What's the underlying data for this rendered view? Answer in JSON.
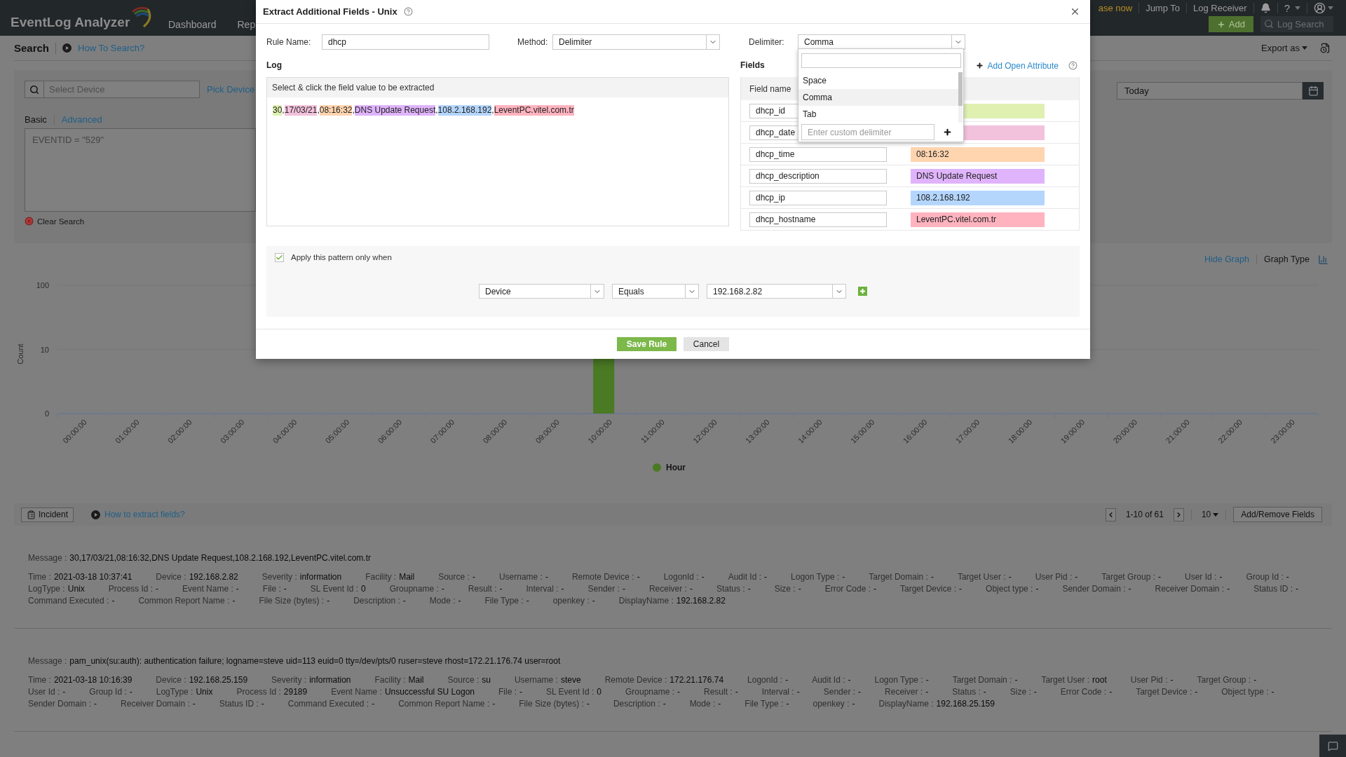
{
  "header": {
    "logo": "EventLog Analyzer",
    "nav": [
      "Dashboard",
      "Rep"
    ],
    "promo": "ase now",
    "links": [
      "Jump To",
      "Log Receiver"
    ],
    "help": "?",
    "add_button": "Add",
    "log_search": {
      "placeholder": "Log Search"
    }
  },
  "page": {
    "title": "Search",
    "help_link": "How To Search?",
    "export": "Export as"
  },
  "search_panel": {
    "device_field": {
      "placeholder": "Select Device"
    },
    "pick_device": "Pick Device",
    "tabs": [
      {
        "label": "Basic",
        "selected": true
      },
      {
        "label": "Advanced",
        "selected": false
      }
    ],
    "query": {
      "placeholder": "EVENTID = \"529\""
    },
    "clear": "Clear Search",
    "date_field": {
      "value": "Today"
    }
  },
  "graph": {
    "hide_link": "Hide Graph",
    "graph_type": "Graph Type",
    "y_title": "Count",
    "y_ticks": [
      "100",
      "10",
      "0"
    ],
    "x_ticks": [
      "00:00:00",
      "01:00:00",
      "02:00:00",
      "03:00:00",
      "04:00:00",
      "05:00:00",
      "06:00:00",
      "07:00:00",
      "08:00:00",
      "09:00:00",
      "10:00:00",
      "11:00:00",
      "12:00:00",
      "13:00:00",
      "14:00:00",
      "15:00:00",
      "16:00:00",
      "17:00:00",
      "18:00:00",
      "19:00:00",
      "20:00:00",
      "21:00:00",
      "22:00:00",
      "23:00:00"
    ],
    "legend": "Hour"
  },
  "results": {
    "incident": "Incident",
    "help_link": "How to extract fields?",
    "range": "1-10 of 61",
    "page_size": "10",
    "add_remove": "Add/Remove Fields",
    "records": [
      {
        "message_label": "Message :",
        "message": "30,17/03/21,08:16:32,DNS Update Request,108.2.168.192,LeventPC.vitel.com.tr",
        "lines": [
          [
            {
              "label": "Time :",
              "value": "2021-03-18 10:37:41"
            },
            {
              "label": "Device :",
              "value": "192.168.2.82"
            },
            {
              "label": "Severity :",
              "value": "information"
            },
            {
              "label": "Facility :",
              "value": "Mail"
            },
            {
              "label": "Source :",
              "value": "-"
            },
            {
              "label": "Username :",
              "value": "-"
            },
            {
              "label": "Remote Device :",
              "value": "-"
            },
            {
              "label": "LogonId :",
              "value": "-"
            },
            {
              "label": "Audit Id :",
              "value": "-"
            },
            {
              "label": "Logon Type :",
              "value": "-"
            },
            {
              "label": "Target Domain :",
              "value": "-"
            },
            {
              "label": "Target User :",
              "value": "-"
            },
            {
              "label": "User Pid :",
              "value": "-"
            },
            {
              "label": "Target Group :",
              "value": "-"
            },
            {
              "label": "User Id :",
              "value": "-"
            },
            {
              "label": "Group Id :",
              "value": "-"
            }
          ],
          [
            {
              "label": "LogType :",
              "value": "Unix"
            },
            {
              "label": "Process Id :",
              "value": "-"
            },
            {
              "label": "Event Name :",
              "value": "-"
            },
            {
              "label": "File :",
              "value": "-"
            },
            {
              "label": "SL Event Id :",
              "value": "0"
            },
            {
              "label": "Groupname :",
              "value": "-"
            },
            {
              "label": "Result :",
              "value": "-"
            },
            {
              "label": "Interval :",
              "value": "-"
            },
            {
              "label": "Sender :",
              "value": "-"
            },
            {
              "label": "Receiver :",
              "value": "-"
            },
            {
              "label": "Status :",
              "value": "-"
            },
            {
              "label": "Size :",
              "value": "-"
            },
            {
              "label": "Error Code :",
              "value": "-"
            },
            {
              "label": "Target Device :",
              "value": "-"
            },
            {
              "label": "Object type :",
              "value": "-"
            },
            {
              "label": "Sender Domain :",
              "value": "-"
            },
            {
              "label": "Receiver Domain :",
              "value": "-"
            },
            {
              "label": "Status ID :",
              "value": "-"
            }
          ],
          [
            {
              "label": "Command Executed :",
              "value": "-"
            },
            {
              "label": "Common Report Name :",
              "value": "-"
            },
            {
              "label": "File Size (bytes) :",
              "value": "-"
            },
            {
              "label": "Description :",
              "value": "-"
            },
            {
              "label": "Mode :",
              "value": "-"
            },
            {
              "label": "File Type :",
              "value": "-"
            },
            {
              "label": "openkey :",
              "value": "-"
            },
            {
              "label": "DisplayName :",
              "value": "192.168.2.82"
            }
          ]
        ]
      },
      {
        "message_label": "Message :",
        "message": "pam_unix(su:auth): authentication failure; logname=steve uid=113 euid=0 tty=/dev/pts/0 ruser=steve rhost=172.21.176.74 user=root",
        "lines": [
          [
            {
              "label": "Time :",
              "value": "2021-03-18 10:16:39"
            },
            {
              "label": "Device :",
              "value": "192.168.25.159"
            },
            {
              "label": "Severity :",
              "value": "information"
            },
            {
              "label": "Facility :",
              "value": "Mail"
            },
            {
              "label": "Source :",
              "value": "su"
            },
            {
              "label": "Username :",
              "value": "steve"
            },
            {
              "label": "Remote Device :",
              "value": "172.21.176.74"
            },
            {
              "label": "LogonId :",
              "value": "-"
            },
            {
              "label": "Audit Id :",
              "value": "-"
            },
            {
              "label": "Logon Type :",
              "value": "-"
            },
            {
              "label": "Target Domain :",
              "value": "-"
            },
            {
              "label": "Target User :",
              "value": "root"
            },
            {
              "label": "User Pid :",
              "value": "-"
            },
            {
              "label": "Target Group :",
              "value": "-"
            }
          ],
          [
            {
              "label": "User Id :",
              "value": "-"
            },
            {
              "label": "Group Id :",
              "value": "-"
            },
            {
              "label": "LogType :",
              "value": "Unix"
            },
            {
              "label": "Process Id :",
              "value": "29189"
            },
            {
              "label": "Event Name :",
              "value": "Unsuccessful SU Logon"
            },
            {
              "label": "File :",
              "value": "-"
            },
            {
              "label": "SL Event Id :",
              "value": "0"
            },
            {
              "label": "Groupname :",
              "value": "-"
            },
            {
              "label": "Result :",
              "value": "-"
            },
            {
              "label": "Interval :",
              "value": "-"
            },
            {
              "label": "Sender :",
              "value": "-"
            },
            {
              "label": "Receiver :",
              "value": "-"
            },
            {
              "label": "Status :",
              "value": "-"
            },
            {
              "label": "Size :",
              "value": "-"
            },
            {
              "label": "Error Code :",
              "value": "-"
            },
            {
              "label": "Target Device :",
              "value": "-"
            },
            {
              "label": "Object type :",
              "value": "-"
            }
          ],
          [
            {
              "label": "Sender Domain :",
              "value": "-"
            },
            {
              "label": "Receiver Domain :",
              "value": "-"
            },
            {
              "label": "Status ID :",
              "value": "-"
            },
            {
              "label": "Command Executed :",
              "value": "-"
            },
            {
              "label": "Common Report Name :",
              "value": "-"
            },
            {
              "label": "File Size (bytes) :",
              "value": "-"
            },
            {
              "label": "Description :",
              "value": "-"
            },
            {
              "label": "Mode :",
              "value": "-"
            },
            {
              "label": "File Type :",
              "value": "-"
            },
            {
              "label": "openkey :",
              "value": "-"
            },
            {
              "label": "DisplayName :",
              "value": "192.168.25.159"
            }
          ]
        ]
      }
    ]
  },
  "dialog": {
    "title": "Extract Additional Fields - Unix",
    "rule_name": {
      "label": "Rule Name:",
      "value": "dhcp"
    },
    "method": {
      "label": "Method:",
      "value": "Delimiter"
    },
    "delimiter": {
      "label": "Delimiter:",
      "value": "Comma",
      "expanded": true,
      "options": [
        {
          "label": "Space",
          "selected": false
        },
        {
          "label": "Comma",
          "selected": true
        },
        {
          "label": "Tab",
          "selected": false
        }
      ],
      "custom": {
        "placeholder": "Enter custom delimiter"
      }
    },
    "log": {
      "title": "Log",
      "hint": "Select & click the field value to be extracted",
      "tokens": [
        {
          "kind": "value",
          "text": "30",
          "color": "#dff0b1"
        },
        {
          "kind": "separator",
          "text": ","
        },
        {
          "kind": "value",
          "text": "17/03/21",
          "color": "#f2c2dc"
        },
        {
          "kind": "separator",
          "text": ","
        },
        {
          "kind": "value",
          "text": "08:16:32",
          "color": "#ffd5b0"
        },
        {
          "kind": "separator",
          "text": ","
        },
        {
          "kind": "value",
          "text": "DNS Update Request",
          "color": "#e0b4fc"
        },
        {
          "kind": "separator",
          "text": ","
        },
        {
          "kind": "value",
          "text": "108.2.168.192",
          "color": "#b4d6fd"
        },
        {
          "kind": "separator",
          "text": ","
        },
        {
          "kind": "value",
          "text": "LeventPC.vitel.com.tr",
          "color": "#ffb3bf"
        }
      ]
    },
    "fields": {
      "title": "Fields",
      "add_link": "Add Open Attribute",
      "columns": [
        "Field name"
      ],
      "rows": [
        {
          "name": "dhcp_id",
          "color": "#dff0b1"
        },
        {
          "name": "dhcp_date",
          "color": "#f2c2dc"
        },
        {
          "name": "dhcp_time",
          "value": "08:16:32",
          "color": "#ffd5b0"
        },
        {
          "name": "dhcp_description",
          "value": "DNS Update Request",
          "color": "#e0b4fc"
        },
        {
          "name": "dhcp_ip",
          "value": "108.2.168.192",
          "color": "#b4d6fd"
        },
        {
          "name": "dhcp_hostname",
          "value": "LeventPC.vitel.com.tr",
          "color": "#ffb3bf"
        }
      ]
    },
    "condition": {
      "label": "Apply this pattern only when",
      "checked": true,
      "field": "Device",
      "operator": "Equals",
      "value": "192.168.2.82"
    },
    "buttons": [
      {
        "label": "Save Rule",
        "kind": "primary"
      },
      {
        "label": "Cancel",
        "kind": "secondary"
      }
    ]
  }
}
